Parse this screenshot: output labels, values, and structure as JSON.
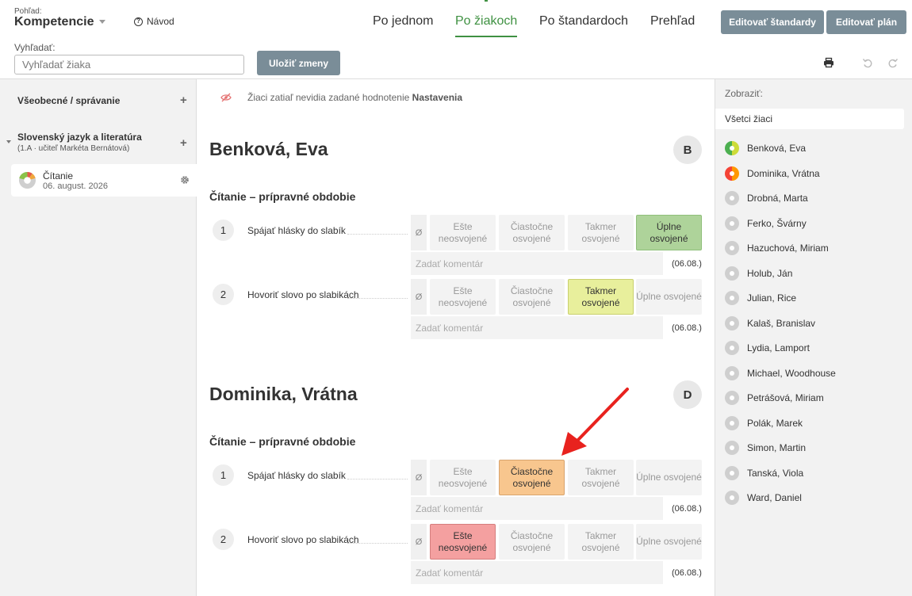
{
  "header": {
    "view_label": "Pohľad:",
    "view_value": "Kompetencie",
    "help_label": "Návod",
    "tabs": [
      {
        "label": "Po jednom",
        "active": false
      },
      {
        "label": "Po žiakoch",
        "active": true
      },
      {
        "label": "Po štandardoch",
        "active": false
      },
      {
        "label": "Prehľad",
        "active": false
      }
    ],
    "edit_standards": "Editovať štandardy",
    "edit_plan": "Editovať plán",
    "search_label": "Vyhľadať:",
    "search_placeholder": "Vyhľadať žiaka",
    "save_label": "Uložiť zmeny",
    "accent_color": "#3f9142"
  },
  "left": {
    "general": "Všeobecné / správanie",
    "subject": "Slovenský jazyk a literatúra",
    "subject_sub": "(1.A · učiteľ Markéta Bernátová)",
    "card_title": "Čítanie",
    "card_date": "06. august. 2026"
  },
  "main": {
    "notice_text": "Žiaci zatiaľ nevidia zadané hodnotenie",
    "notice_link": "Nastavenia",
    "null_symbol": "Ø",
    "levels": [
      "Ešte neosvojené",
      "Čiastočne osvojené",
      "Takmer osvojené",
      "Úplne osvojené"
    ],
    "students": [
      {
        "name": "Benková, Eva",
        "grade": "B",
        "section": "Čítanie – prípravné obdobie",
        "standards": [
          {
            "num": "1",
            "label": "Spájať hlásky do slabík",
            "selected": 3,
            "comment_placeholder": "Zadať komentár",
            "date": "(06.08.)"
          },
          {
            "num": "2",
            "label": "Hovoriť slovo po slabikách",
            "selected": 2,
            "comment_placeholder": "Zadať komentár",
            "date": "(06.08.)"
          }
        ]
      },
      {
        "name": "Dominika, Vrátna",
        "grade": "D",
        "section": "Čítanie – prípravné obdobie",
        "standards": [
          {
            "num": "1",
            "label": "Spájať hlásky do slabík",
            "selected": 1,
            "comment_placeholder": "Zadať komentár",
            "date": "(06.08.)"
          },
          {
            "num": "2",
            "label": "Hovoriť slovo po slabikách",
            "selected": 0,
            "comment_placeholder": "Zadať komentár",
            "date": "(06.08.)"
          }
        ]
      }
    ]
  },
  "right": {
    "show_label": "Zobraziť:",
    "filter": "Všetci žiaci",
    "students": [
      {
        "name": "Benková, Eva",
        "status": "green-yellow"
      },
      {
        "name": "Dominika, Vrátna",
        "status": "orange-red"
      },
      {
        "name": "Drobná, Marta",
        "status": "none"
      },
      {
        "name": "Ferko, Švárny",
        "status": "none"
      },
      {
        "name": "Hazuchová, Miriam",
        "status": "none"
      },
      {
        "name": "Holub, Ján",
        "status": "none"
      },
      {
        "name": "Julian, Rice",
        "status": "none"
      },
      {
        "name": "Kalaš, Branislav",
        "status": "none"
      },
      {
        "name": "Lydia, Lamport",
        "status": "none"
      },
      {
        "name": "Michael, Woodhouse",
        "status": "none"
      },
      {
        "name": "Petrášová, Miriam",
        "status": "none"
      },
      {
        "name": "Polák, Marek",
        "status": "none"
      },
      {
        "name": "Simon, Martin",
        "status": "none"
      },
      {
        "name": "Tanská, Viola",
        "status": "none"
      },
      {
        "name": "Ward, Daniel",
        "status": "none"
      }
    ]
  }
}
